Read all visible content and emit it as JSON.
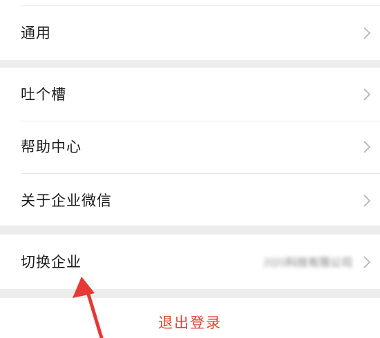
{
  "menu": {
    "general": {
      "label": "通用"
    },
    "feedback": {
      "label": "吐个槽"
    },
    "help": {
      "label": "帮助中心"
    },
    "about": {
      "label": "关于企业微信"
    },
    "switch_company": {
      "label": "切换企业",
      "value": "川川科技有限公司"
    }
  },
  "logout": {
    "label": "退出登录"
  },
  "icons": {
    "chevron": "chevron-right-icon",
    "annotation": "red-arrow-annotation"
  },
  "colors": {
    "page_bg": "#ededed",
    "row_bg": "#ffffff",
    "text": "#1a1a1a",
    "logout": "#e0452e",
    "annotation": "#e53935",
    "chevron": "#b2b2b2"
  }
}
